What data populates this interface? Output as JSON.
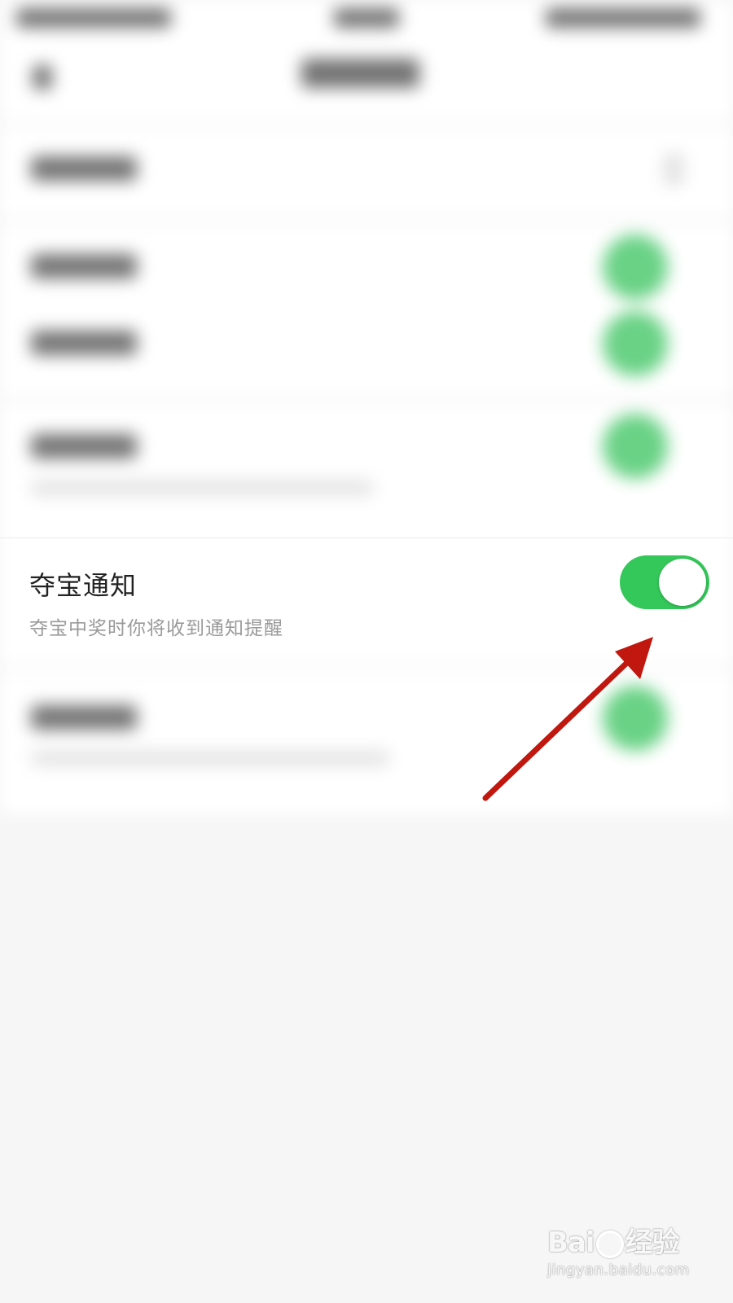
{
  "focus_row": {
    "title": "夺宝通知",
    "description": "夺宝中奖时你将收到通知提醒",
    "toggle_on": true
  },
  "colors": {
    "toggle_on": "#34c759",
    "arrow": "#c0170f",
    "background": "#f6f6f6"
  },
  "watermark": {
    "brand_left": "Bai",
    "brand_right": "经验",
    "url": "jingyan.baidu.com"
  }
}
